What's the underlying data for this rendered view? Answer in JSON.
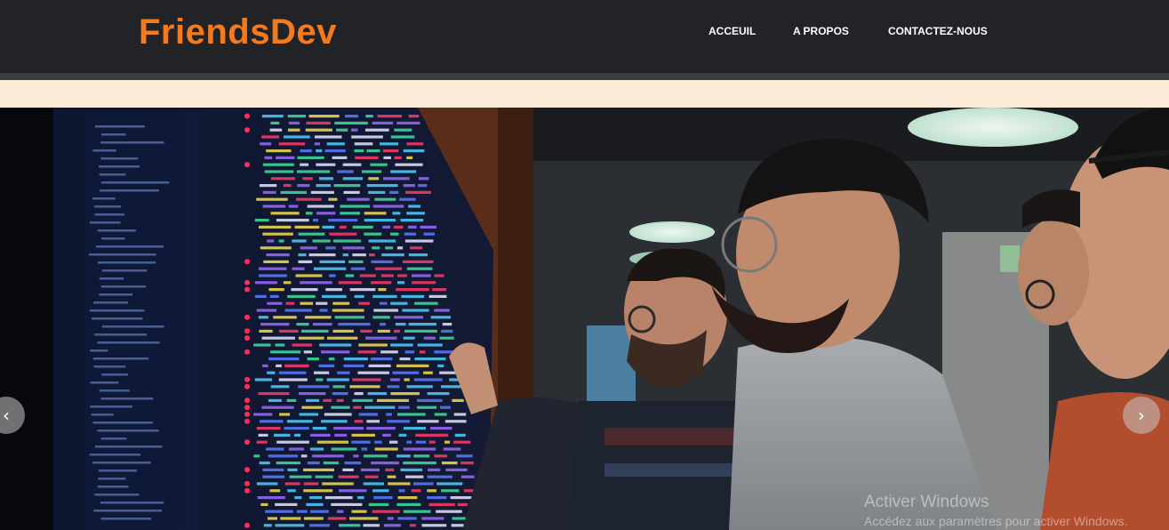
{
  "header": {
    "brand": "FriendsDev",
    "nav": {
      "home": "ACCEUIL",
      "about": "A PROPOS",
      "contact": "CONTACTEZ-NOUS"
    }
  },
  "carousel": {
    "prev_label": "‹",
    "next_label": "›"
  },
  "watermark": {
    "title": "Activer Windows",
    "subtitle": "Accédez aux paramètres pour activer Windows."
  },
  "colors": {
    "header_bg": "#212327",
    "brand": "#f47a20",
    "band": "#fbebd7"
  }
}
